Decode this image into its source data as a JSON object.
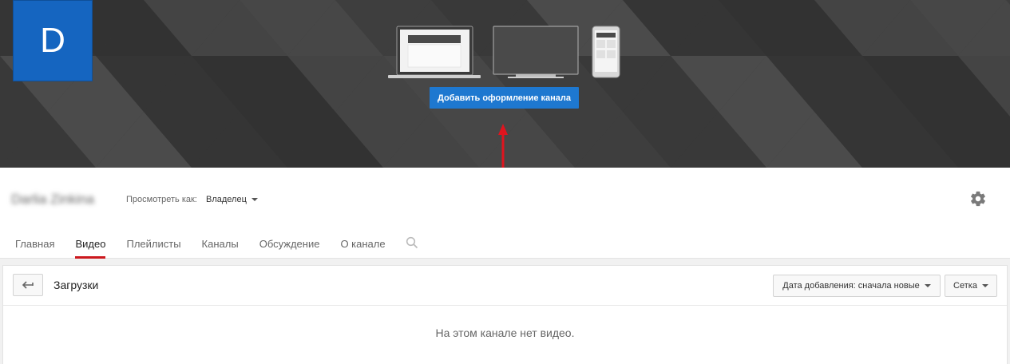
{
  "banner": {
    "avatar_letter": "D",
    "add_art_label": "Добавить оформление канала",
    "bg_color": "#3b3b3b",
    "button_color": "#1e78d0",
    "arrow_color": "#e0141e"
  },
  "header": {
    "channel_name": "Darlia Zinkina",
    "view_as_label": "Просмотреть как:",
    "view_as_value": "Владелец"
  },
  "tabs": [
    {
      "label": "Главная",
      "active": false
    },
    {
      "label": "Видео",
      "active": true
    },
    {
      "label": "Плейлисты",
      "active": false
    },
    {
      "label": "Каналы",
      "active": false
    },
    {
      "label": "Обсуждение",
      "active": false
    },
    {
      "label": "О канале",
      "active": false
    }
  ],
  "content": {
    "title": "Загрузки",
    "sort_label": "Дата добавления: сначала новые",
    "view_label": "Сетка",
    "empty_message": "На этом канале нет видео."
  }
}
